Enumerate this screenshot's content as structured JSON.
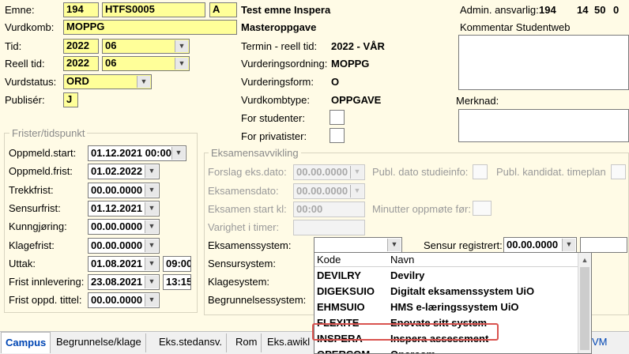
{
  "labels": {
    "emne": "Emne:",
    "vurdkomb": "Vurdkomb:",
    "tid": "Tid:",
    "reell_tid": "Reell tid:",
    "vurdstatus": "Vurdstatus:",
    "publiser": "Publisér:",
    "termin": "Termin - reell tid:",
    "vurderingsordning": "Vurderingsordning:",
    "vurderingsform": "Vurderingsform:",
    "vurdkombtype": "Vurdkombtype:",
    "for_studenter": "For studenter:",
    "for_privatister": "For privatister:",
    "admin": "Admin. ansvarlig:",
    "kommentar": "Kommentar Studentweb",
    "merknad": "Merknad:"
  },
  "values": {
    "emne_code": "194",
    "emne_id": "HTFS0005",
    "emne_var": "A",
    "emne_name": "Test emne Inspera",
    "vurdkomb": "MOPPG",
    "vurdkomb_name": "Masteroppgave",
    "tid_year": "2022",
    "tid_sem": "06",
    "reell_year": "2022",
    "reell_sem": "06",
    "vurdstatus": "ORD",
    "publiser": "J",
    "termin": "2022  - VÅR",
    "vurderingsordning": "MOPPG",
    "vurderingsform": "O",
    "vurdkombtype": "OPPGAVE",
    "admin_1": "194",
    "admin_2": "14",
    "admin_3": "50",
    "admin_4": "0"
  },
  "frister": {
    "legend": "Frister/tidspunkt",
    "oppmeld_start_lbl": "Oppmeld.start:",
    "oppmeld_start": "01.12.2021 00:00",
    "oppmeld_frist_lbl": "Oppmeld.frist:",
    "oppmeld_frist": "01.02.2022",
    "trekkfrist_lbl": "Trekkfrist:",
    "trekkfrist": "00.00.0000",
    "sensurfrist_lbl": "Sensurfrist:",
    "sensurfrist": "01.12.2021",
    "kunngjoring_lbl": "Kunngjøring:",
    "kunngjoring": "00.00.0000",
    "klagefrist_lbl": "Klagefrist:",
    "klagefrist": "00.00.0000",
    "uttak_lbl": "Uttak:",
    "uttak": "01.08.2021",
    "uttak_time": "09:00",
    "frist_innlevering_lbl": "Frist innlevering:",
    "frist_innlevering": "23.08.2021",
    "frist_innlevering_time": "13:15",
    "frist_oppd_lbl": "Frist oppd. tittel:",
    "frist_oppd": "00.00.0000"
  },
  "eksamen": {
    "legend": "Eksamensavvikling",
    "forslag_lbl": "Forslag eks.dato:",
    "forslag": "00.00.0000",
    "publ_dato_lbl": "Publ. dato studieinfo:",
    "publ_kand_lbl": "Publ. kandidat. timeplan",
    "eksamensdato_lbl": "Eksamensdato:",
    "eksamensdato": "00.00.0000",
    "start_lbl": "Eksamen start kl:",
    "start": "00:00",
    "minutter_lbl": "Minutter oppmøte før:",
    "varighet_lbl": "Varighet i timer:",
    "system_lbl": "Eksamenssystem:",
    "sensur_reg_lbl": "Sensur registrert:",
    "sensur_reg": "00.00.0000",
    "sensursystem_lbl": "Sensursystem:",
    "klagesystem_lbl": "Klagesystem:",
    "begrunnelse_lbl": "Begrunnelsessystem:"
  },
  "dropdown": {
    "col_kode": "Kode",
    "col_navn": "Navn",
    "rows": [
      {
        "kode": "DEVILRY",
        "navn": "Devilry"
      },
      {
        "kode": "DIGEKSUIO",
        "navn": "Digitalt eksamenssystem UiO"
      },
      {
        "kode": "EHMSUIO",
        "navn": "HMS e-læringssystem UiO"
      },
      {
        "kode": "FLEXITE",
        "navn": "Enovate sitt system"
      },
      {
        "kode": "INSPERA",
        "navn": "Inspera assessment"
      },
      {
        "kode": "QPERCOM",
        "navn": "Qpercom"
      }
    ],
    "highlighted": "INSPERA"
  },
  "tabs": [
    {
      "label": "Campus"
    },
    {
      "label": "Begrunnelse/klage"
    },
    {
      "label": "Eks.stedansv."
    },
    {
      "label": "Rom"
    },
    {
      "label": "Eks.awikl"
    },
    {
      "label": "VM"
    }
  ],
  "colors": {
    "bg": "#fffbe6",
    "field_yellow": "#ffff99",
    "highlight": "#d9534f",
    "tab_active": "#0046b4"
  }
}
